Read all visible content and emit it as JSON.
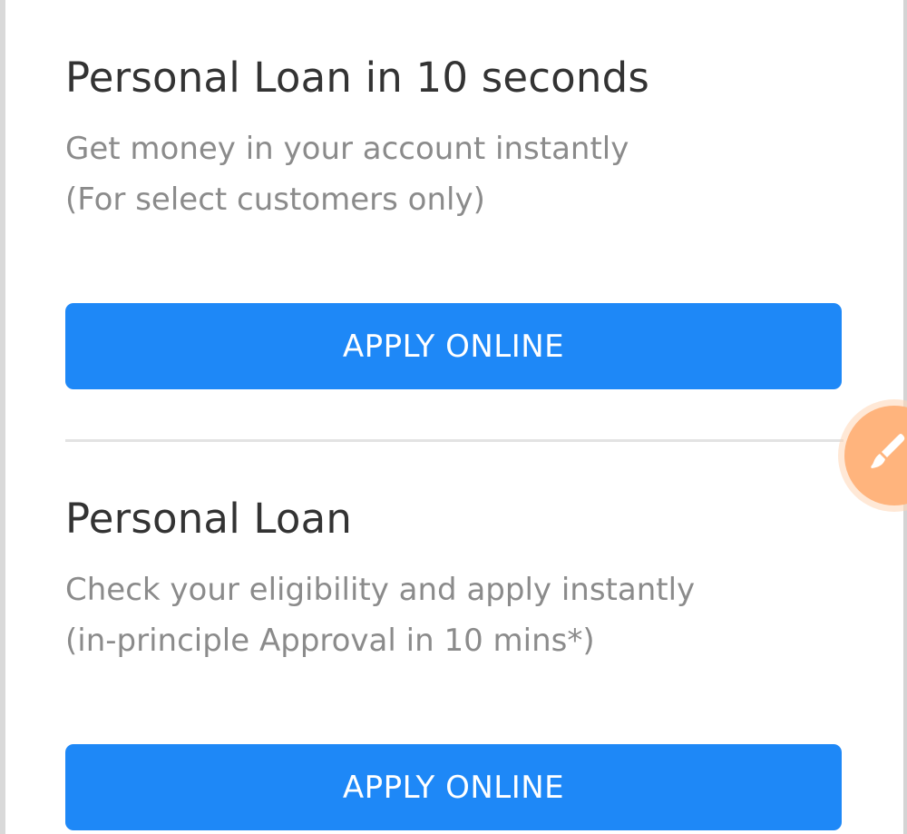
{
  "offers": [
    {
      "title": "Personal Loan in 10 seconds",
      "description_line1": "Get money in your account instantly",
      "description_line2": "(For select customers only)",
      "button_label": "APPLY ONLINE"
    },
    {
      "title": "Personal Loan",
      "description_line1": "Check your eligibility and apply instantly",
      "description_line2": "(in-principle Approval in 10 mins*)",
      "button_label": "APPLY ONLINE"
    }
  ],
  "floating_button": {
    "icon": "brush-icon",
    "color": "#ffb47d"
  },
  "colors": {
    "accent": "#1e88f7",
    "title": "#333333",
    "description": "#8b8b8b"
  }
}
